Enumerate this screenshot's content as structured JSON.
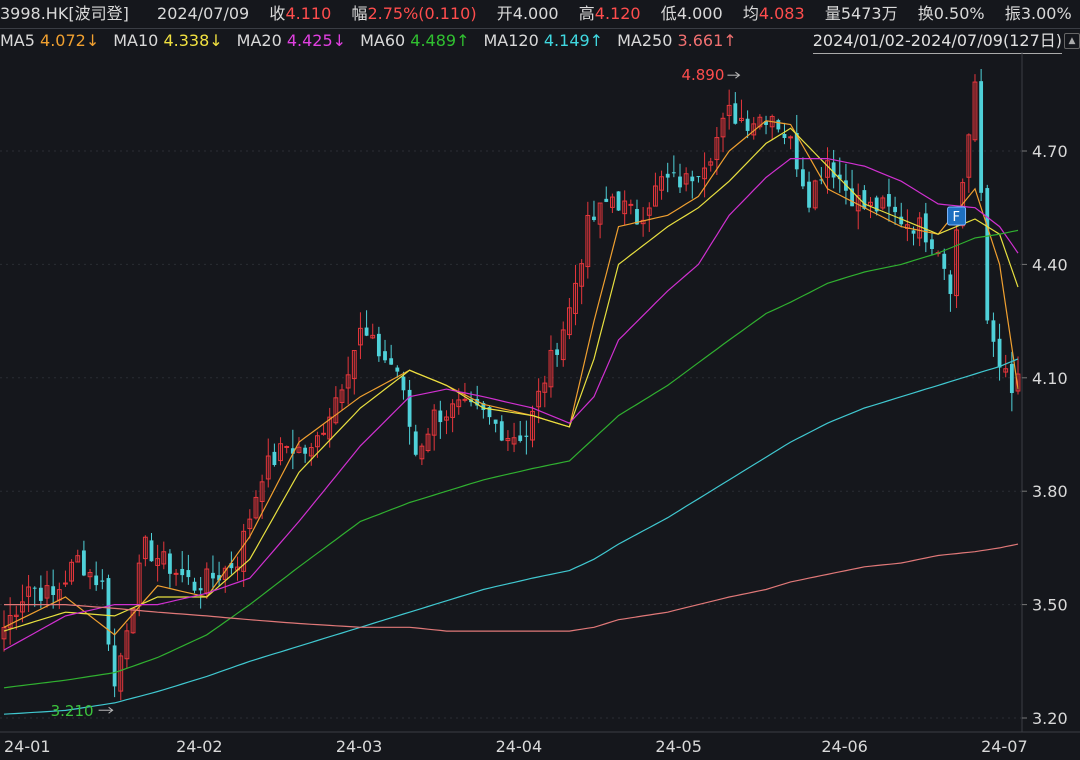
{
  "header": {
    "code": "3998.HK[波司登]",
    "date": "2024/07/09",
    "close_label": "收",
    "close": "4.110",
    "change_label": "幅",
    "change": "2.75%(0.110)",
    "open_label": "开",
    "open": "4.000",
    "high_label": "高",
    "high": "4.120",
    "low_label": "低",
    "low": "4.000",
    "avg_label": "均",
    "avg": "4.083",
    "vol_label": "量",
    "vol": "5473万",
    "turnover_label": "换",
    "turnover": "0.50%",
    "amp_label": "振",
    "amp": "3.00%"
  },
  "ma_legend": [
    {
      "name": "MA5",
      "value": "4.072",
      "arrow": "↓",
      "color": "#f0a030"
    },
    {
      "name": "MA10",
      "value": "4.338",
      "arrow": "↓",
      "color": "#f0e040"
    },
    {
      "name": "MA20",
      "value": "4.425",
      "arrow": "↓",
      "color": "#e040e0"
    },
    {
      "name": "MA60",
      "value": "4.489",
      "arrow": "↑",
      "color": "#30c030"
    },
    {
      "name": "MA120",
      "value": "4.149",
      "arrow": "↑",
      "color": "#40d8e0"
    },
    {
      "name": "MA250",
      "value": "3.661",
      "arrow": "↑",
      "color": "#f07070"
    }
  ],
  "date_range": "2024/01/02-2024/07/09(127日)",
  "range_button": "▲",
  "colors": {
    "up": "#e6363c",
    "down": "#4fd1d9",
    "text": "#d9d9d9",
    "grid": "#2a2d33",
    "red": "#ff4d4d",
    "green": "#3cc33c"
  },
  "chart_data": {
    "type": "candlestick",
    "ylim": [
      3.18,
      4.95
    ],
    "yticks": [
      "4.70",
      "4.40",
      "4.10",
      "3.80",
      "3.50",
      "3.20"
    ],
    "ytick_values": [
      4.7,
      4.4,
      4.1,
      3.8,
      3.5,
      3.2
    ],
    "xticks": [
      "24-01",
      "24-02",
      "24-03",
      "24-04",
      "24-05",
      "24-06",
      "24-07"
    ],
    "xtick_index": [
      0,
      28,
      54,
      80,
      106,
      133,
      159
    ],
    "annotations": [
      {
        "label": "4.890",
        "index": 120,
        "value": 4.89,
        "color": "#ff4d4d"
      },
      {
        "label": "3.210",
        "index": 18,
        "value": 3.21,
        "color": "#3cc33c"
      }
    ],
    "flag": {
      "label": "F",
      "index": 155
    },
    "n_candles": 166,
    "ma": {
      "ma5": [
        [
          0,
          3.44
        ],
        [
          10,
          3.52
        ],
        [
          18,
          3.42
        ],
        [
          25,
          3.55
        ],
        [
          33,
          3.52
        ],
        [
          40,
          3.68
        ],
        [
          48,
          3.93
        ],
        [
          58,
          4.05
        ],
        [
          66,
          4.12
        ],
        [
          72,
          4.08
        ],
        [
          78,
          4.03
        ],
        [
          86,
          4.0
        ],
        [
          92,
          3.97
        ],
        [
          96,
          4.25
        ],
        [
          100,
          4.5
        ],
        [
          108,
          4.53
        ],
        [
          113,
          4.58
        ],
        [
          118,
          4.7
        ],
        [
          124,
          4.78
        ],
        [
          128,
          4.77
        ],
        [
          134,
          4.6
        ],
        [
          140,
          4.55
        ],
        [
          146,
          4.5
        ],
        [
          152,
          4.48
        ],
        [
          158,
          4.6
        ],
        [
          162,
          4.4
        ],
        [
          165,
          4.07
        ]
      ],
      "ma10": [
        [
          0,
          3.43
        ],
        [
          10,
          3.48
        ],
        [
          18,
          3.47
        ],
        [
          25,
          3.52
        ],
        [
          33,
          3.52
        ],
        [
          40,
          3.62
        ],
        [
          48,
          3.85
        ],
        [
          58,
          4.02
        ],
        [
          66,
          4.12
        ],
        [
          72,
          4.08
        ],
        [
          78,
          4.02
        ],
        [
          86,
          4.0
        ],
        [
          92,
          3.97
        ],
        [
          96,
          4.15
        ],
        [
          100,
          4.4
        ],
        [
          108,
          4.5
        ],
        [
          113,
          4.55
        ],
        [
          118,
          4.62
        ],
        [
          124,
          4.72
        ],
        [
          128,
          4.76
        ],
        [
          134,
          4.66
        ],
        [
          140,
          4.56
        ],
        [
          146,
          4.52
        ],
        [
          152,
          4.48
        ],
        [
          158,
          4.52
        ],
        [
          162,
          4.48
        ],
        [
          165,
          4.34
        ]
      ],
      "ma20": [
        [
          0,
          3.38
        ],
        [
          10,
          3.47
        ],
        [
          18,
          3.5
        ],
        [
          25,
          3.5
        ],
        [
          33,
          3.53
        ],
        [
          40,
          3.57
        ],
        [
          48,
          3.72
        ],
        [
          58,
          3.92
        ],
        [
          66,
          4.05
        ],
        [
          72,
          4.07
        ],
        [
          78,
          4.05
        ],
        [
          86,
          4.02
        ],
        [
          92,
          3.98
        ],
        [
          96,
          4.05
        ],
        [
          100,
          4.2
        ],
        [
          108,
          4.33
        ],
        [
          113,
          4.4
        ],
        [
          118,
          4.53
        ],
        [
          124,
          4.63
        ],
        [
          128,
          4.68
        ],
        [
          134,
          4.68
        ],
        [
          140,
          4.66
        ],
        [
          146,
          4.62
        ],
        [
          152,
          4.56
        ],
        [
          158,
          4.55
        ],
        [
          162,
          4.5
        ],
        [
          165,
          4.43
        ]
      ],
      "ma60": [
        [
          0,
          3.28
        ],
        [
          10,
          3.3
        ],
        [
          18,
          3.32
        ],
        [
          25,
          3.36
        ],
        [
          33,
          3.42
        ],
        [
          40,
          3.5
        ],
        [
          48,
          3.6
        ],
        [
          58,
          3.72
        ],
        [
          66,
          3.77
        ],
        [
          72,
          3.8
        ],
        [
          78,
          3.83
        ],
        [
          86,
          3.86
        ],
        [
          92,
          3.88
        ],
        [
          96,
          3.94
        ],
        [
          100,
          4.0
        ],
        [
          108,
          4.08
        ],
        [
          113,
          4.14
        ],
        [
          118,
          4.2
        ],
        [
          124,
          4.27
        ],
        [
          128,
          4.3
        ],
        [
          134,
          4.35
        ],
        [
          140,
          4.38
        ],
        [
          146,
          4.4
        ],
        [
          152,
          4.43
        ],
        [
          158,
          4.47
        ],
        [
          162,
          4.48
        ],
        [
          165,
          4.49
        ]
      ],
      "ma120": [
        [
          0,
          3.21
        ],
        [
          10,
          3.22
        ],
        [
          18,
          3.24
        ],
        [
          25,
          3.27
        ],
        [
          33,
          3.31
        ],
        [
          40,
          3.35
        ],
        [
          48,
          3.39
        ],
        [
          58,
          3.44
        ],
        [
          66,
          3.48
        ],
        [
          72,
          3.51
        ],
        [
          78,
          3.54
        ],
        [
          86,
          3.57
        ],
        [
          92,
          3.59
        ],
        [
          96,
          3.62
        ],
        [
          100,
          3.66
        ],
        [
          108,
          3.73
        ],
        [
          113,
          3.78
        ],
        [
          118,
          3.83
        ],
        [
          124,
          3.89
        ],
        [
          128,
          3.93
        ],
        [
          134,
          3.98
        ],
        [
          140,
          4.02
        ],
        [
          146,
          4.05
        ],
        [
          152,
          4.08
        ],
        [
          158,
          4.11
        ],
        [
          162,
          4.13
        ],
        [
          165,
          4.15
        ]
      ],
      "ma250": [
        [
          0,
          3.5
        ],
        [
          10,
          3.5
        ],
        [
          18,
          3.49
        ],
        [
          25,
          3.48
        ],
        [
          33,
          3.47
        ],
        [
          40,
          3.46
        ],
        [
          48,
          3.45
        ],
        [
          58,
          3.44
        ],
        [
          66,
          3.44
        ],
        [
          72,
          3.43
        ],
        [
          78,
          3.43
        ],
        [
          86,
          3.43
        ],
        [
          92,
          3.43
        ],
        [
          96,
          3.44
        ],
        [
          100,
          3.46
        ],
        [
          108,
          3.48
        ],
        [
          113,
          3.5
        ],
        [
          118,
          3.52
        ],
        [
          124,
          3.54
        ],
        [
          128,
          3.56
        ],
        [
          134,
          3.58
        ],
        [
          140,
          3.6
        ],
        [
          146,
          3.61
        ],
        [
          152,
          3.63
        ],
        [
          158,
          3.64
        ],
        [
          162,
          3.65
        ],
        [
          165,
          3.66
        ]
      ]
    },
    "price_path": [
      [
        0,
        3.44
      ],
      [
        4,
        3.55
      ],
      [
        8,
        3.52
      ],
      [
        12,
        3.62
      ],
      [
        16,
        3.55
      ],
      [
        18,
        3.28
      ],
      [
        20,
        3.45
      ],
      [
        23,
        3.65
      ],
      [
        27,
        3.6
      ],
      [
        31,
        3.55
      ],
      [
        35,
        3.58
      ],
      [
        38,
        3.62
      ],
      [
        42,
        3.85
      ],
      [
        46,
        3.92
      ],
      [
        50,
        3.9
      ],
      [
        54,
        4.05
      ],
      [
        58,
        4.22
      ],
      [
        62,
        4.15
      ],
      [
        64,
        4.12
      ],
      [
        67,
        3.9
      ],
      [
        70,
        4.0
      ],
      [
        74,
        4.02
      ],
      [
        78,
        4.0
      ],
      [
        82,
        3.95
      ],
      [
        85,
        3.95
      ],
      [
        88,
        4.1
      ],
      [
        92,
        4.28
      ],
      [
        95,
        4.5
      ],
      [
        99,
        4.58
      ],
      [
        103,
        4.52
      ],
      [
        107,
        4.62
      ],
      [
        111,
        4.62
      ],
      [
        115,
        4.7
      ],
      [
        118,
        4.8
      ],
      [
        121,
        4.78
      ],
      [
        125,
        4.8
      ],
      [
        128,
        4.72
      ],
      [
        131,
        4.58
      ],
      [
        134,
        4.68
      ],
      [
        137,
        4.6
      ],
      [
        140,
        4.55
      ],
      [
        143,
        4.55
      ],
      [
        146,
        4.52
      ],
      [
        149,
        4.5
      ],
      [
        152,
        4.45
      ],
      [
        154,
        4.35
      ],
      [
        156,
        4.62
      ],
      [
        158,
        4.88
      ],
      [
        160,
        4.25
      ],
      [
        162,
        4.15
      ],
      [
        164,
        4.05
      ],
      [
        165,
        4.11
      ]
    ]
  }
}
